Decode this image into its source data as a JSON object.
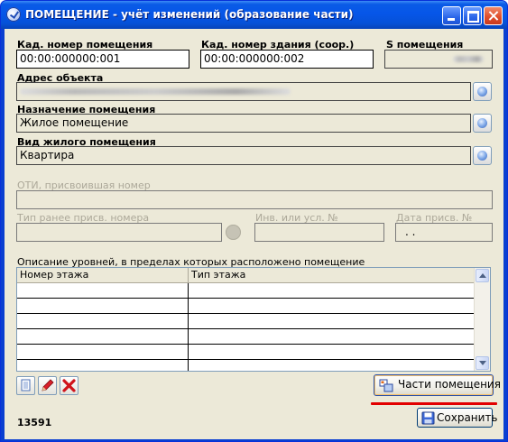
{
  "window": {
    "title": "ПОМЕЩЕНИЕ - учёт изменений (образование части)"
  },
  "fields": {
    "cad_room": {
      "label": "Кад. номер помещения",
      "value": "00:00:000000:001"
    },
    "cad_building": {
      "label": "Кад. номер здания (соор.)",
      "value": "00:00:000000:002"
    },
    "area": {
      "label": "S помещения",
      "value": ""
    },
    "address": {
      "label": "Адрес объекта",
      "value": ""
    },
    "purpose": {
      "label": "Назначение помещения",
      "value": "Жилое помещение"
    },
    "living_type": {
      "label": "Вид жилого помещения",
      "value": "Квартира"
    },
    "oti": {
      "label": "ОТИ, присвоившая номер",
      "value": ""
    },
    "prev_num_type": {
      "label": "Тип ранее присв. номера",
      "value": ""
    },
    "inv_num": {
      "label": "Инв. или усл. №",
      "value": ""
    },
    "assign_date": {
      "label": "Дата присв. №",
      "value": ". ."
    }
  },
  "levels": {
    "caption": "Описание уровней, в пределах которых расположено помещение",
    "columns": [
      "Номер этажа",
      "Тип этажа"
    ],
    "rows": [
      [
        "",
        ""
      ],
      [
        "",
        ""
      ],
      [
        "",
        ""
      ],
      [
        "",
        ""
      ],
      [
        "",
        ""
      ],
      [
        "",
        ""
      ]
    ]
  },
  "buttons": {
    "parts": "Части помещения",
    "save": "Сохранить"
  },
  "status": {
    "record_id": "13591"
  },
  "colors": {
    "titlebar": "#0656e8",
    "highlight": "#e20000",
    "face": "#ece9d8"
  }
}
